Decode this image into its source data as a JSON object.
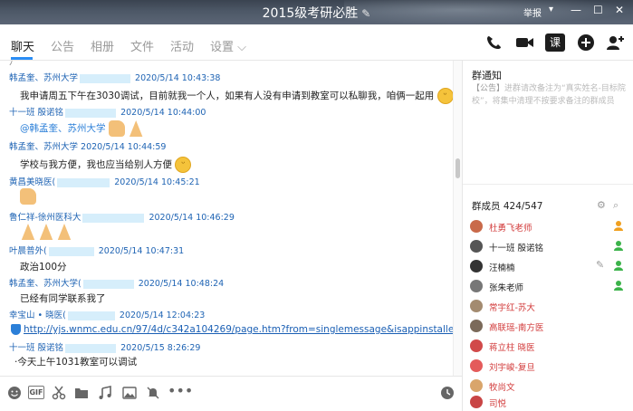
{
  "window": {
    "title": "2015级考研必胜",
    "report_label": "举报",
    "min_glyph": "—",
    "max_glyph": "☐",
    "close_glyph": "✕"
  },
  "tabs": [
    {
      "label": "聊天",
      "active": true
    },
    {
      "label": "公告"
    },
    {
      "label": "相册"
    },
    {
      "label": "文件"
    },
    {
      "label": "活动"
    },
    {
      "label": "设置 ⌵"
    }
  ],
  "toolbar": {
    "lesson_label": "课"
  },
  "messages": {
    "m1": {
      "name": "韩孟奎、苏州大学",
      "time": "2020/5/14 10:43:38",
      "text": "我申请周五下午在3030调试，目前就我一个人，如果有人没有申请到教室可以私聊我，咱俩一起用"
    },
    "m2": {
      "name": "十一班  殷诺铭",
      "time": "2020/5/14 10:44:00",
      "mention": "@韩孟奎、苏州大学"
    },
    "m3": {
      "name": "韩孟奎、苏州大学",
      "time": "2020/5/14 10:44:59",
      "text": "学校与我方便，我也应当给别人方便"
    },
    "m4": {
      "name": "黄昌美晓医",
      "time": "2020/5/14 10:45:21"
    },
    "m5": {
      "name": "鲁仁祥-徐州医科大",
      "time": "2020/5/14 10:46:29"
    },
    "m6": {
      "name": "叶晨普外",
      "time": "2020/5/14 10:47:31",
      "text": "政治100分"
    },
    "m7": {
      "name": "韩孟奎、苏州大学",
      "time": "2020/5/14 10:48:24",
      "text": "已经有同学联系我了"
    },
    "m8": {
      "name": "幸宝山 • 晓医",
      "time": "2020/5/14 12:04:23",
      "link": "http://yjs.wnmc.edu.cn/97/4d/c342a104269/page.htm?from=singlemessage&isappinstalled=0"
    },
    "m9": {
      "name": "十一班  殷诺铭",
      "time": "2020/5/15 8:26:29",
      "text": "今天上午1031教室可以调试"
    }
  },
  "notice": {
    "title": "群通知",
    "tag": "【公告】",
    "body": "进群请改备注为“真实姓名-目标院校”，将集中清理不按要求备注的群成员"
  },
  "members_panel": {
    "title": "群成员 424/547",
    "items": [
      {
        "name": "杜勇飞老师",
        "color": "#d23a3a"
      },
      {
        "name": "十一班  殷诺铭",
        "color": "#222222"
      },
      {
        "name": "汪楠楠",
        "color": "#222222"
      },
      {
        "name": "张朱老师",
        "color": "#222222"
      },
      {
        "name": "常宇红-苏大",
        "color": "#d23a3a"
      },
      {
        "name": "高联瑶-南方医",
        "color": "#d23a3a"
      },
      {
        "name": "蒋立柱 晓医",
        "color": "#d23a3a"
      },
      {
        "name": "刘宇峻-复旦",
        "color": "#d23a3a"
      },
      {
        "name": "牧尚文",
        "color": "#d23a3a"
      },
      {
        "name": "司悦",
        "color": "#d23a3a"
      }
    ]
  },
  "colors": {
    "accent": "#2b8ef6",
    "name_blue": "#1f64b4",
    "admin_red": "#d23a3a"
  }
}
